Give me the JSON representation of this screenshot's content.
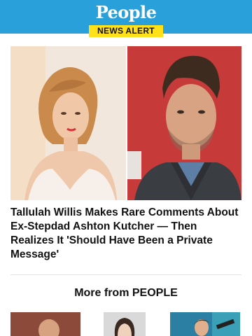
{
  "header": {
    "logo_text": "People",
    "badge": "NEWS ALERT",
    "colors": {
      "bar": "#2aa0db",
      "badge_bg": "#ffe11a"
    }
  },
  "article": {
    "headline": "Tallulah Willis Makes Rare Comments About Ex-Stepdad Ashton Kutcher — Then Realizes It 'Should Have Been a Private Message'",
    "images": [
      {
        "icon": "woman-portrait-photo"
      },
      {
        "icon": "man-portrait-photo"
      }
    ]
  },
  "more": {
    "title": "More from PEOPLE",
    "thumbnails": [
      {
        "icon": "man-in-suit-photo"
      },
      {
        "icon": "woman-portrait-photo"
      },
      {
        "icon": "performer-photo"
      }
    ]
  }
}
